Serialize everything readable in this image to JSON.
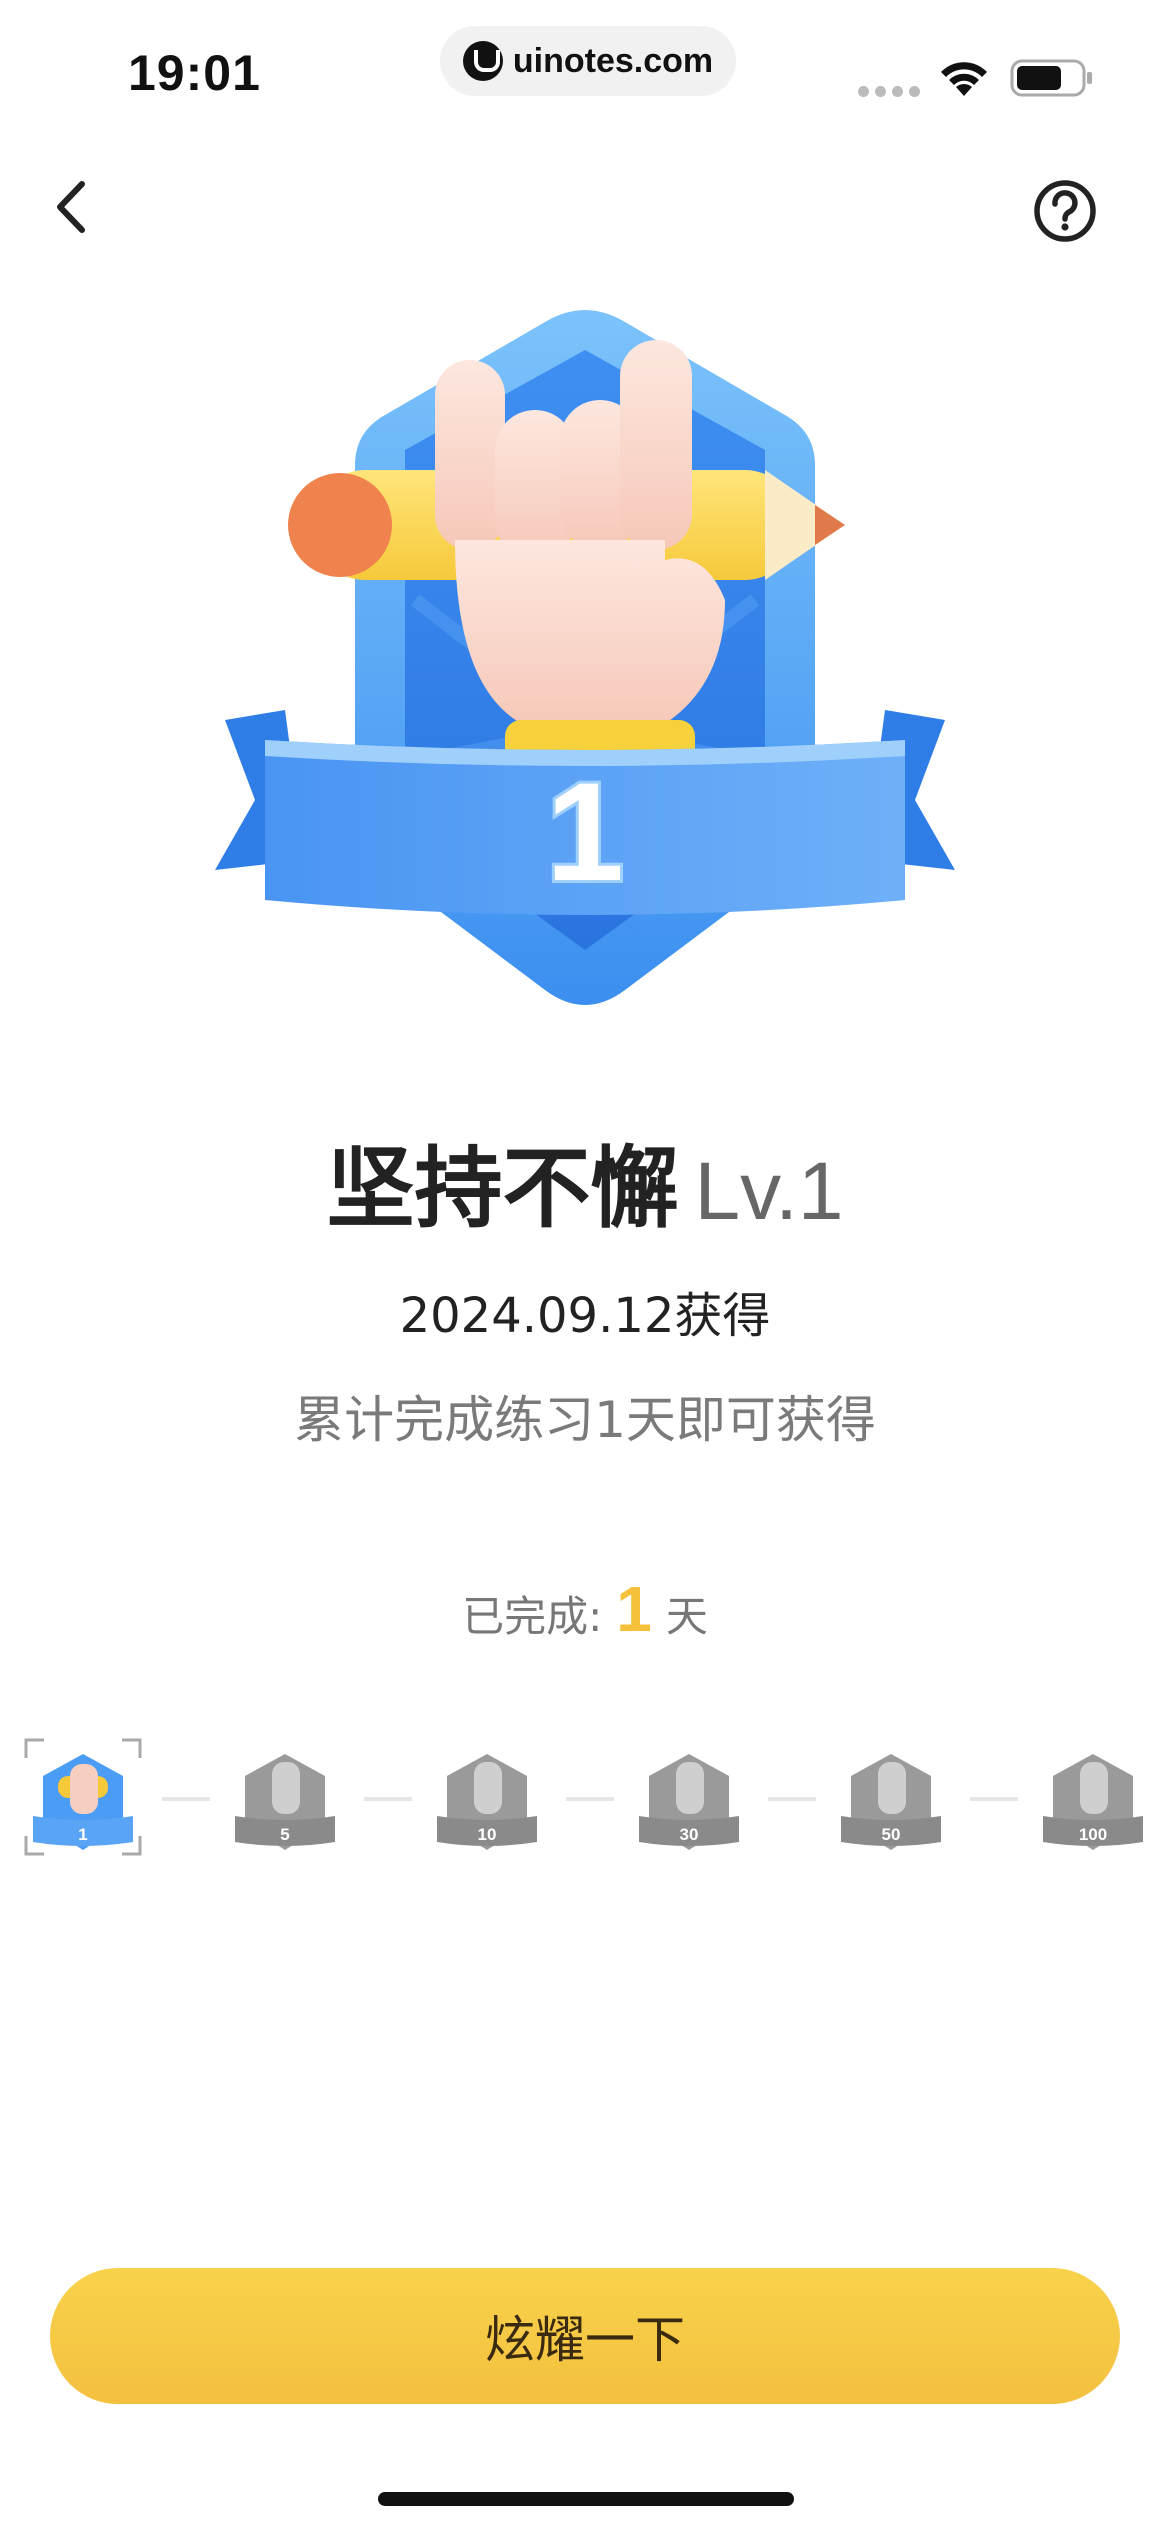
{
  "status_bar": {
    "time": "19:01",
    "url": "uinotes.com"
  },
  "nav": {
    "back_icon": "chevron-left-icon",
    "help_icon": "question-circle-icon"
  },
  "badge": {
    "level_number": "1",
    "name": "坚持不懈",
    "level_label": "Lv.1",
    "earned_date": "2024.09.12获得",
    "requirement": "累计完成练习1天即可获得"
  },
  "progress": {
    "label": "已完成:",
    "count": "1",
    "unit": "天"
  },
  "levels": [
    {
      "label": "1",
      "unlocked": true,
      "selected": true
    },
    {
      "label": "5",
      "unlocked": false,
      "selected": false
    },
    {
      "label": "10",
      "unlocked": false,
      "selected": false
    },
    {
      "label": "30",
      "unlocked": false,
      "selected": false
    },
    {
      "label": "50",
      "unlocked": false,
      "selected": false
    },
    {
      "label": "100",
      "unlocked": false,
      "selected": false
    }
  ],
  "share_button": "炫耀一下",
  "colors": {
    "accent_yellow": "#f4c03f",
    "badge_blue": "#4b9cf5",
    "progress_number": "#f5c13a"
  }
}
